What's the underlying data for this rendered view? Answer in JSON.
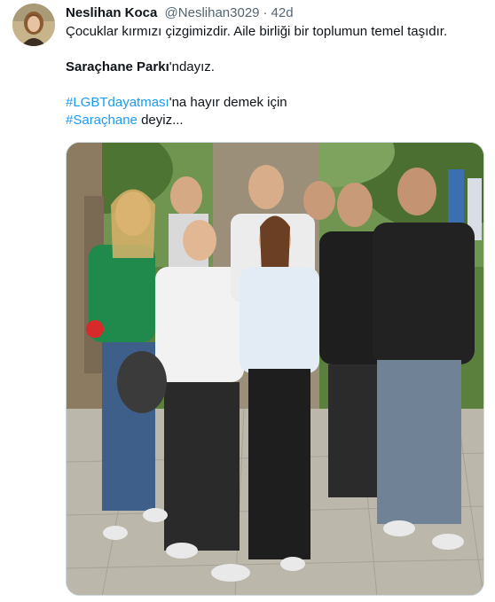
{
  "tweet": {
    "author": {
      "display_name": "Neslihan Koca",
      "handle": "@Neslihan3029",
      "avatar_icon": "profile-photo"
    },
    "separator": "·",
    "time": "42d",
    "text": {
      "line1": "Çocuklar kırmızı çizgimizdir. Aile birliği bir toplumun temel taşıdır.",
      "line2_bold": "Saraçhane Parkı",
      "line2_rest": "'ndayız.",
      "hashtag1": "#LGBTdayatması",
      "hashtag1_rest": "'na hayır demek için",
      "hashtag2": "#Saraçhane",
      "hashtag2_rest": " deyiz..."
    },
    "media": {
      "kind": "photo",
      "accent_colors": {
        "trees": "#3e6a2c",
        "pavement": "#b7b2a6",
        "green_shirt": "#1f8a4c",
        "black_shirt": "#1e1e1e",
        "white_shirt": "#f2f2f2"
      }
    }
  }
}
